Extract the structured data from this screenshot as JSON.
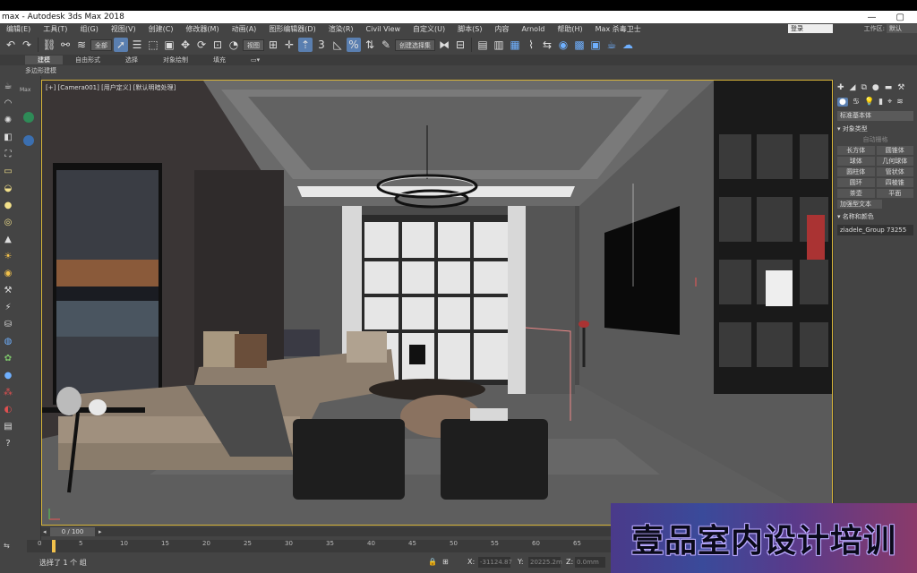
{
  "titlebar": {
    "title": "max - Autodesk 3ds Max 2018",
    "minimize": "—",
    "maximize": "▢"
  },
  "menu": {
    "items": [
      "编辑(E)",
      "工具(T)",
      "组(G)",
      "视图(V)",
      "创建(C)",
      "修改器(M)",
      "动画(A)",
      "图形编辑器(D)",
      "渲染(R)",
      "Civil View",
      "自定义(U)",
      "脚本(S)",
      "内容",
      "Arnold",
      "帮助(H)",
      "Max 杀毒卫士"
    ],
    "workspace_user": "登录",
    "workspace_label": "工作区:",
    "workspace_value": "默认"
  },
  "toolbar": {
    "filter_select": "全部",
    "refcoord_select": "视图",
    "named_selection": "创建选择集"
  },
  "ribbon": {
    "tabs": [
      "建模",
      "自由形式",
      "选择",
      "对象绘制",
      "填充"
    ],
    "active_tab": "建模",
    "sub_label": "多边形建模"
  },
  "viewport": {
    "label": "[+] [Camera001] [用户定义] [默认明暗处理]"
  },
  "command_panel": {
    "category_dropdown": "标准基本体",
    "object_type_header": "对象类型",
    "autogrid_label": "自动栅格",
    "object_buttons": [
      "长方体",
      "圆锥体",
      "球体",
      "几何球体",
      "圆柱体",
      "管状体",
      "圆环",
      "四棱锥",
      "茶壶",
      "平面"
    ],
    "extra_button": "加强型文本",
    "name_color_header": "名称和颜色",
    "object_name": "ziadele_Group 73255"
  },
  "timeline": {
    "frame_display": "0 / 100",
    "ticks": [
      "0",
      "5",
      "10",
      "15",
      "20",
      "25",
      "30",
      "35",
      "40",
      "45",
      "50",
      "55",
      "60",
      "65"
    ]
  },
  "status": {
    "selection_text": "选择了 1 个 组",
    "x_label": "X:",
    "x_value": "-31124.87",
    "y_label": "Y:",
    "y_value": "20225.2m",
    "z_label": "Z:",
    "z_value": "0.0mm"
  },
  "watermark": {
    "text": "壹品室内设计培训"
  }
}
